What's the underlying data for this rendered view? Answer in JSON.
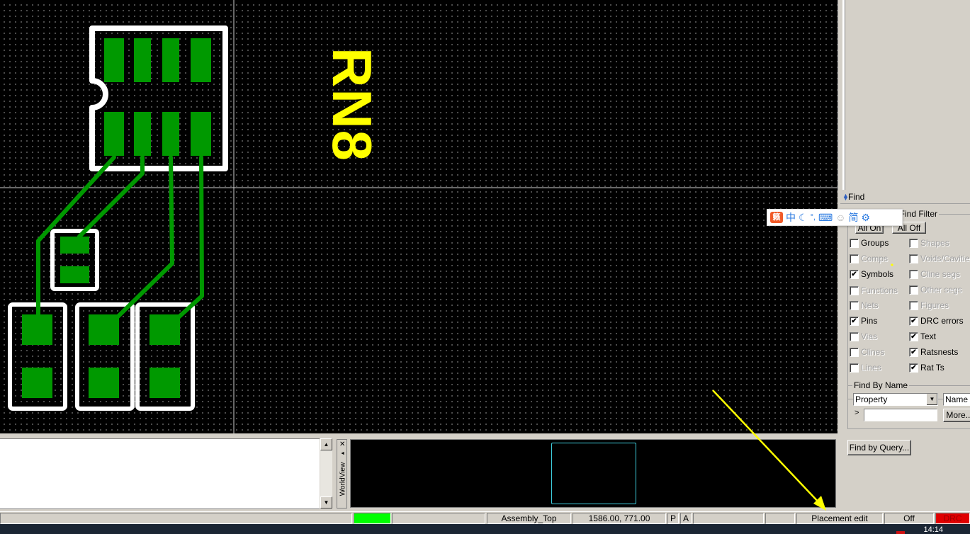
{
  "canvas": {
    "refdes_label": "RN8",
    "colors": {
      "background": "#000000",
      "pad": "#009900",
      "outline": "#ffffff",
      "refdes": "#ffff00",
      "grid": "#5a5a5a"
    }
  },
  "ime_toolbar": {
    "logo": "籁",
    "mode": "中",
    "moon_icon": "☾",
    "punct_icon": "°,",
    "keyboard_icon": "⌨",
    "user_icon": "☺",
    "simplified": "简",
    "settings_icon": "⚙"
  },
  "find_panel": {
    "title": "Find",
    "filter_group_label": "t Find Filter",
    "all_on_label": "All On",
    "all_off_label": "All Off",
    "checkboxes_left": [
      {
        "label": "Groups",
        "checked": false,
        "enabled": true
      },
      {
        "label": "Comps",
        "checked": false,
        "enabled": false
      },
      {
        "label": "Symbols",
        "checked": true,
        "enabled": true
      },
      {
        "label": "Functions",
        "checked": false,
        "enabled": false
      },
      {
        "label": "Nets",
        "checked": false,
        "enabled": false
      },
      {
        "label": "Pins",
        "checked": true,
        "enabled": true
      },
      {
        "label": "Vias",
        "checked": false,
        "enabled": false
      },
      {
        "label": "Clines",
        "checked": false,
        "enabled": false
      },
      {
        "label": "Lines",
        "checked": false,
        "enabled": false
      }
    ],
    "checkboxes_right": [
      {
        "label": "Shapes",
        "checked": false,
        "enabled": false
      },
      {
        "label": "Voids/Cavitie",
        "checked": false,
        "enabled": false
      },
      {
        "label": "Cline segs",
        "checked": false,
        "enabled": false
      },
      {
        "label": "Other segs",
        "checked": false,
        "enabled": false
      },
      {
        "label": "Figures",
        "checked": false,
        "enabled": false
      },
      {
        "label": "DRC errors",
        "checked": true,
        "enabled": true
      },
      {
        "label": "Text",
        "checked": true,
        "enabled": true
      },
      {
        "label": "Ratsnests",
        "checked": true,
        "enabled": true
      },
      {
        "label": "Rat Ts",
        "checked": true,
        "enabled": true
      }
    ],
    "find_by_name_label": "Find By Name",
    "property_value": "Property",
    "name_value": "Name",
    "name_input_prefix": ">",
    "name_input_value": "",
    "more_label": "More...",
    "find_by_query_label": "Find by Query..."
  },
  "worldview": {
    "label": "WorldView",
    "close_icon": "✕",
    "pin_icon": "◄"
  },
  "command_window": {
    "text": "",
    "scroll_up": "▲",
    "scroll_down": "▼"
  },
  "statusbar": {
    "indicator_color": "#00ff00",
    "layer": "Assembly_Top",
    "coordinates": "1586.00, 771.00",
    "p_button": "P",
    "a_button": "A",
    "mode": "Placement edit",
    "drc_state": "Off",
    "drc_label": "DRC",
    "drc_color": "#e00000"
  },
  "taskbar": {
    "clock": "14:14"
  }
}
